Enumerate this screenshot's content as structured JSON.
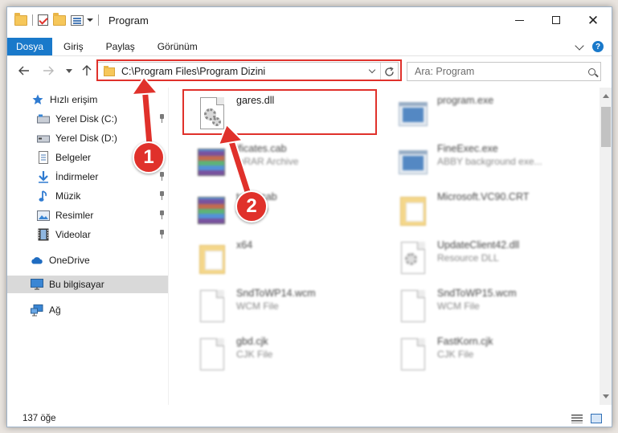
{
  "window": {
    "title": "Program"
  },
  "ribbon": {
    "tabs": [
      "Dosya",
      "Giriş",
      "Paylaş",
      "Görünüm"
    ]
  },
  "address": {
    "path": "C:\\Program Files\\Program Dizini"
  },
  "search": {
    "placeholder": "Ara: Program"
  },
  "sidebar": {
    "items": [
      {
        "label": "Hızlı erişim",
        "icon": "star-icon"
      },
      {
        "label": "Yerel Disk (C:)",
        "icon": "drive-icon"
      },
      {
        "label": "Yerel Disk (D:)",
        "icon": "drive-icon"
      },
      {
        "label": "Belgeler",
        "icon": "documents-icon"
      },
      {
        "label": "İndirmeler",
        "icon": "download-icon"
      },
      {
        "label": "Müzik",
        "icon": "music-icon"
      },
      {
        "label": "Resimler",
        "icon": "pictures-icon"
      },
      {
        "label": "Videolar",
        "icon": "videos-icon"
      },
      {
        "label": "OneDrive",
        "icon": "cloud-icon"
      },
      {
        "label": "Bu bilgisayar",
        "icon": "computer-icon"
      },
      {
        "label": "Ağ",
        "icon": "network-icon"
      }
    ]
  },
  "files": [
    {
      "name": "gares.dll",
      "type": ""
    },
    {
      "name": "program.exe",
      "type": ""
    },
    {
      "name": "ificates.cab",
      "type": "inRAR Archive"
    },
    {
      "name": "FineExec.exe",
      "type": "ABBY background exe..."
    },
    {
      "name": "tates.cab",
      "type": "Archive"
    },
    {
      "name": "Microsoft.VC90.CRT",
      "type": ""
    },
    {
      "name": "x64",
      "type": ""
    },
    {
      "name": "UpdateClient42.dll",
      "type": "Resource DLL"
    },
    {
      "name": "SndToWP14.wcm",
      "type": "WCM File"
    },
    {
      "name": "SndToWP15.wcm",
      "type": "WCM File"
    },
    {
      "name": "gbd.cjk",
      "type": "CJK File"
    },
    {
      "name": "FastKorn.cjk",
      "type": "CJK File"
    }
  ],
  "annotations": {
    "step1": "1",
    "step2": "2"
  },
  "status": {
    "count": "137 öğe"
  },
  "colors": {
    "accent": "#1979ca",
    "annotation": "#e0312b",
    "selected": "#d9d9d9"
  }
}
